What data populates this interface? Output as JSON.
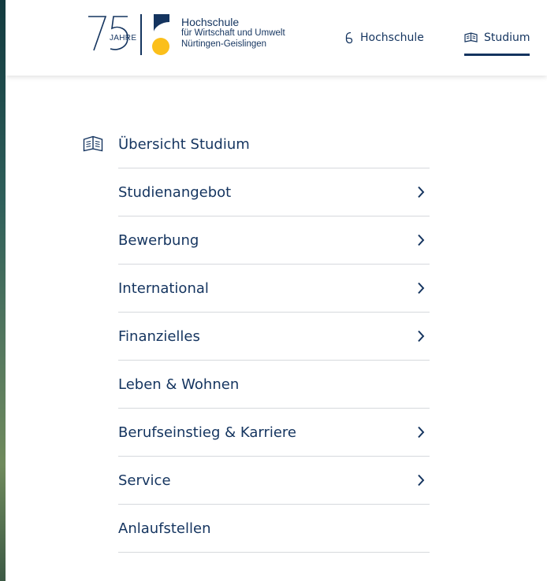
{
  "logo": {
    "anniversary_number": "75",
    "anniversary_word": "JAHRE",
    "name_line1": "Hochschule",
    "name_line2": "für Wirtschaft und Umwelt",
    "name_line3": "Nürtingen-Geislingen"
  },
  "nav": {
    "hochschule_label": "Hochschule",
    "studium_label": "Studium",
    "active": "Studium"
  },
  "menu": {
    "overview_label": "Übersicht Studium",
    "items": [
      {
        "label": "Studienangebot",
        "has_submenu": true
      },
      {
        "label": "Bewerbung",
        "has_submenu": true
      },
      {
        "label": "International",
        "has_submenu": true
      },
      {
        "label": "Finanzielles",
        "has_submenu": true
      },
      {
        "label": "Leben & Wohnen",
        "has_submenu": false
      },
      {
        "label": "Berufseinstieg & Karriere",
        "has_submenu": true
      },
      {
        "label": "Service",
        "has_submenu": true
      },
      {
        "label": "Anlaufstellen",
        "has_submenu": false
      }
    ]
  },
  "colors": {
    "primary": "#14345f",
    "accent": "#fbbf1b",
    "divider": "#d6d9dd"
  }
}
